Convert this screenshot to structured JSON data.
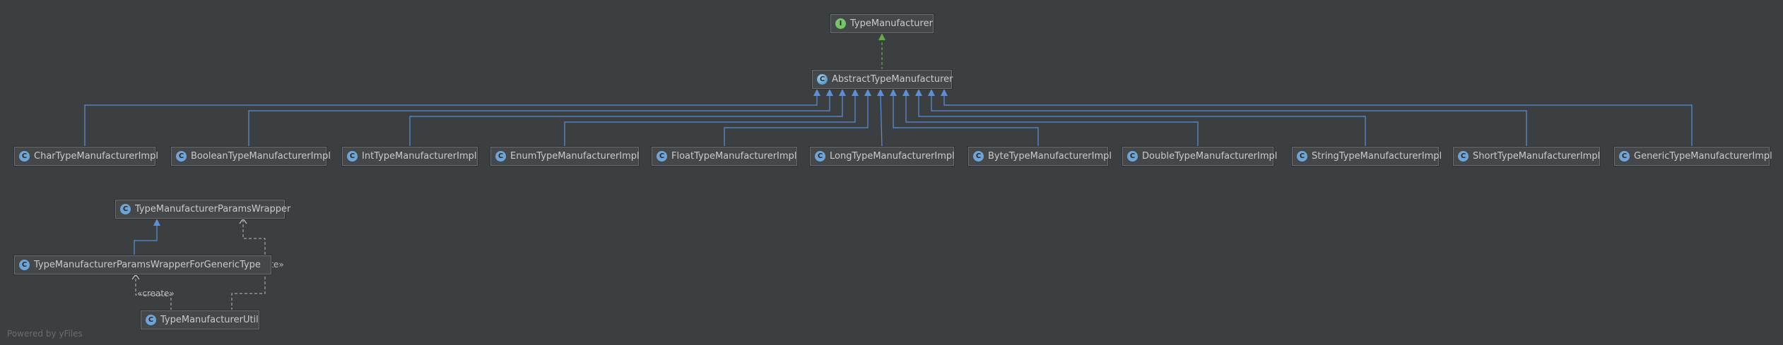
{
  "diagram": {
    "nodes": [
      {
        "id": "type-manufacturer",
        "label": "TypeManufacturer",
        "kind": "interface",
        "icon": "interface-icon"
      },
      {
        "id": "abstract-type-manufacturer",
        "label": "AbstractTypeManufacturer",
        "kind": "abstract-class",
        "icon": "abstract-class-icon"
      },
      {
        "id": "char-impl",
        "label": "CharTypeManufacturerImpl",
        "kind": "class",
        "icon": "class-icon"
      },
      {
        "id": "boolean-impl",
        "label": "BooleanTypeManufacturerImpl",
        "kind": "class",
        "icon": "class-icon"
      },
      {
        "id": "int-impl",
        "label": "IntTypeManufacturerImpl",
        "kind": "class",
        "icon": "class-icon"
      },
      {
        "id": "enum-impl",
        "label": "EnumTypeManufacturerImpl",
        "kind": "class",
        "icon": "class-icon"
      },
      {
        "id": "float-impl",
        "label": "FloatTypeManufacturerImpl",
        "kind": "class",
        "icon": "class-icon"
      },
      {
        "id": "long-impl",
        "label": "LongTypeManufacturerImpl",
        "kind": "class",
        "icon": "class-icon"
      },
      {
        "id": "byte-impl",
        "label": "ByteTypeManufacturerImpl",
        "kind": "class",
        "icon": "class-icon"
      },
      {
        "id": "double-impl",
        "label": "DoubleTypeManufacturerImpl",
        "kind": "class",
        "icon": "class-icon"
      },
      {
        "id": "string-impl",
        "label": "StringTypeManufacturerImpl",
        "kind": "class",
        "icon": "class-icon"
      },
      {
        "id": "short-impl",
        "label": "ShortTypeManufacturerImpl",
        "kind": "class",
        "icon": "class-icon"
      },
      {
        "id": "generic-impl",
        "label": "GenericTypeManufacturerImpl",
        "kind": "class",
        "icon": "class-icon"
      },
      {
        "id": "params-wrapper",
        "label": "TypeManufacturerParamsWrapper",
        "kind": "class",
        "icon": "class-icon"
      },
      {
        "id": "params-wrapper-generic",
        "label": "TypeManufacturerParamsWrapperForGenericType",
        "kind": "class",
        "icon": "class-icon"
      },
      {
        "id": "type-manufacturer-util",
        "label": "TypeManufacturerUtil",
        "kind": "class",
        "icon": "class-icon"
      }
    ],
    "edges": [
      {
        "from": "abstract-type-manufacturer",
        "to": "type-manufacturer",
        "relation": "implements"
      },
      {
        "from": "char-impl",
        "to": "abstract-type-manufacturer",
        "relation": "extends"
      },
      {
        "from": "boolean-impl",
        "to": "abstract-type-manufacturer",
        "relation": "extends"
      },
      {
        "from": "int-impl",
        "to": "abstract-type-manufacturer",
        "relation": "extends"
      },
      {
        "from": "enum-impl",
        "to": "abstract-type-manufacturer",
        "relation": "extends"
      },
      {
        "from": "float-impl",
        "to": "abstract-type-manufacturer",
        "relation": "extends"
      },
      {
        "from": "long-impl",
        "to": "abstract-type-manufacturer",
        "relation": "extends"
      },
      {
        "from": "byte-impl",
        "to": "abstract-type-manufacturer",
        "relation": "extends"
      },
      {
        "from": "double-impl",
        "to": "abstract-type-manufacturer",
        "relation": "extends"
      },
      {
        "from": "string-impl",
        "to": "abstract-type-manufacturer",
        "relation": "extends"
      },
      {
        "from": "short-impl",
        "to": "abstract-type-manufacturer",
        "relation": "extends"
      },
      {
        "from": "generic-impl",
        "to": "abstract-type-manufacturer",
        "relation": "extends"
      },
      {
        "from": "params-wrapper-generic",
        "to": "params-wrapper",
        "relation": "extends"
      },
      {
        "from": "params-wrapper-generic",
        "to": "params-wrapper",
        "relation": "create",
        "label": "«create»"
      },
      {
        "from": "type-manufacturer-util",
        "to": "params-wrapper-generic",
        "relation": "create",
        "label": "«create»"
      }
    ]
  },
  "footer": {
    "text": "Powered by yFiles"
  },
  "colors": {
    "background": "#3c3f41",
    "node_fill": "#45484a",
    "node_border": "#6a6d70",
    "extends_edge": "#5c8fd6",
    "implements_edge": "#6aa84f",
    "dependency_edge": "#b9bbbe",
    "text": "#c8cacc"
  }
}
